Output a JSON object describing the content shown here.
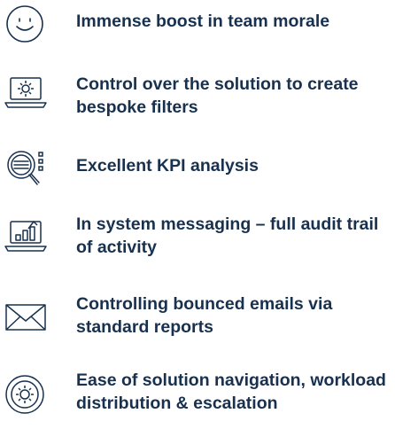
{
  "benefits": [
    {
      "icon": "smiley-face-icon",
      "text": "Immense boost in team morale"
    },
    {
      "icon": "laptop-gear-icon",
      "text": "Control over the solution to create bespoke filters"
    },
    {
      "icon": "magnifier-list-icon",
      "text": "Excellent KPI analysis"
    },
    {
      "icon": "laptop-chart-icon",
      "text": "In system messaging – full audit trail of activity"
    },
    {
      "icon": "envelope-icon",
      "text": "Controlling bounced emails via standard reports"
    },
    {
      "icon": "gear-cycle-icon",
      "text": "Ease of solution navigation, workload distribution & escalation"
    }
  ]
}
